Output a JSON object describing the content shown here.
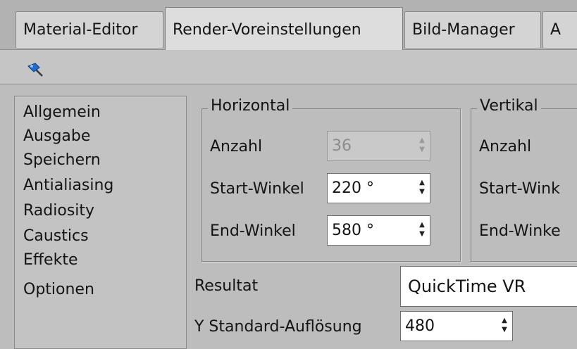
{
  "tabs": [
    {
      "label": "Material-Editor"
    },
    {
      "label": "Render-Voreinstellungen"
    },
    {
      "label": "Bild-Manager"
    },
    {
      "label": "A"
    }
  ],
  "toolbar": {
    "pin_icon": "pin-icon"
  },
  "sidebar": {
    "items": [
      {
        "label": "Allgemein"
      },
      {
        "label": "Ausgabe"
      },
      {
        "label": "Speichern"
      },
      {
        "label": "Antialiasing"
      },
      {
        "label": "Radiosity"
      },
      {
        "label": "Caustics"
      },
      {
        "label": "Effekte"
      },
      {
        "label": "Optionen"
      }
    ]
  },
  "horizontal": {
    "title": "Horizontal",
    "count_label": "Anzahl",
    "count_value": "36",
    "start_label": "Start-Winkel",
    "start_value": "220 °",
    "end_label": "End-Winkel",
    "end_value": "580 °"
  },
  "vertikal": {
    "title": "Vertikal",
    "count_label": "Anzahl",
    "start_label": "Start-Wink",
    "end_label": "End-Winke"
  },
  "result": {
    "label": "Resultat",
    "value": "QuickTime VR"
  },
  "y_resolution": {
    "label": "Y Standard-Auflösung",
    "value": "480"
  },
  "colors": {
    "background": "#bdbdbd",
    "pin_icon": "#1e6fd0"
  }
}
